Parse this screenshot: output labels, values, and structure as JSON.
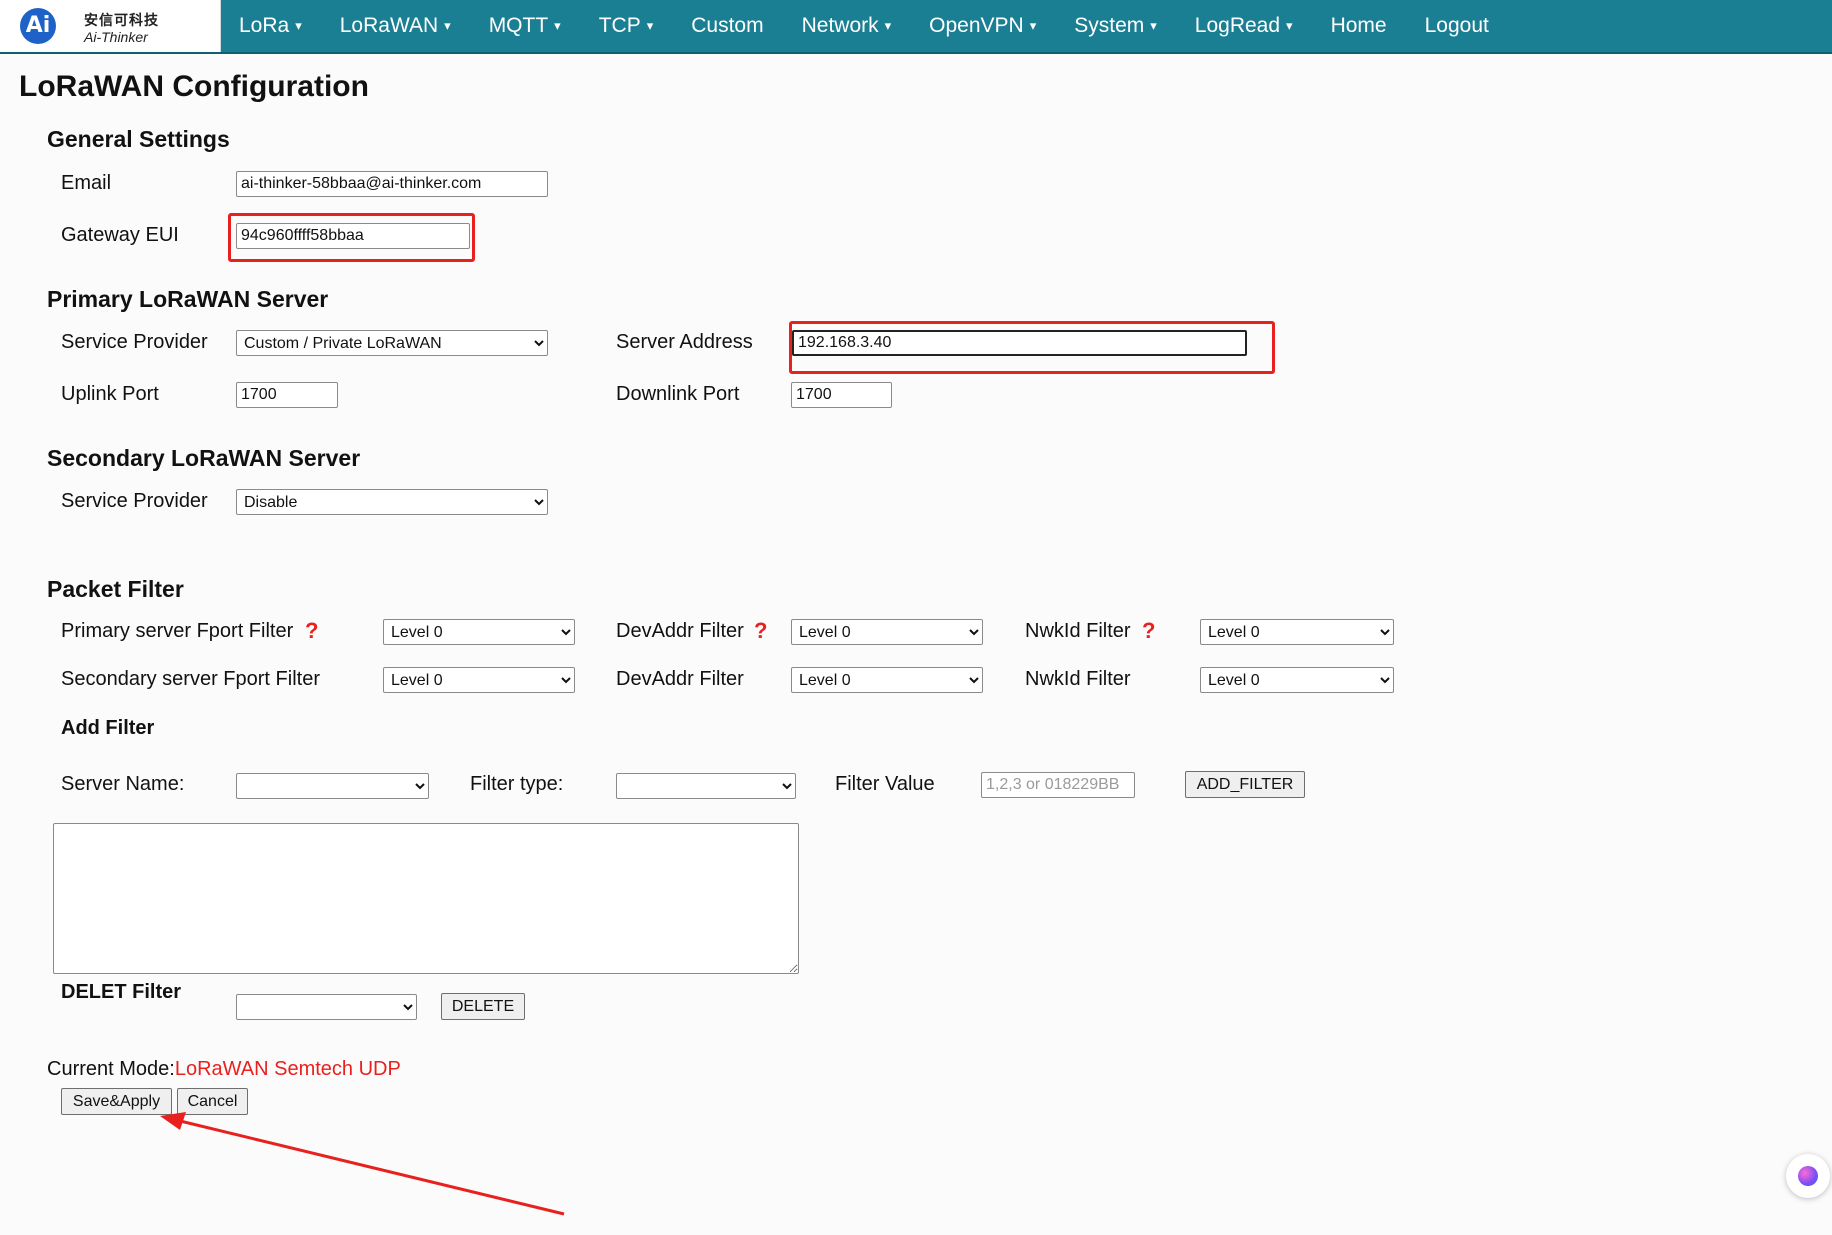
{
  "brand": {
    "cn": "安信可科技",
    "en": "Ai-Thinker",
    "mark": "Ai"
  },
  "nav": {
    "items": [
      {
        "label": "LoRa",
        "dropdown": true
      },
      {
        "label": "LoRaWAN",
        "dropdown": true
      },
      {
        "label": "MQTT",
        "dropdown": true
      },
      {
        "label": "TCP",
        "dropdown": true
      },
      {
        "label": "Custom",
        "dropdown": false
      },
      {
        "label": "Network",
        "dropdown": true
      },
      {
        "label": "OpenVPN",
        "dropdown": true
      },
      {
        "label": "System",
        "dropdown": true
      },
      {
        "label": "LogRead",
        "dropdown": true
      },
      {
        "label": "Home",
        "dropdown": false
      },
      {
        "label": "Logout",
        "dropdown": false
      }
    ],
    "caret": "▾"
  },
  "page": {
    "title": "LoRaWAN Configuration"
  },
  "general": {
    "heading": "General Settings",
    "email_label": "Email",
    "email_value": "ai-thinker-58bbaa@ai-thinker.com",
    "eui_label": "Gateway EUI",
    "eui_value": "94c960ffff58bbaa"
  },
  "primary": {
    "heading": "Primary LoRaWAN Server",
    "provider_label": "Service Provider",
    "provider_value": "Custom / Private LoRaWAN",
    "address_label": "Server Address",
    "address_value": "192.168.3.40",
    "uplink_label": "Uplink Port",
    "uplink_value": "1700",
    "downlink_label": "Downlink Port",
    "downlink_value": "1700"
  },
  "secondary": {
    "heading": "Secondary LoRaWAN Server",
    "provider_label": "Service Provider",
    "provider_value": "Disable"
  },
  "filter": {
    "heading": "Packet Filter",
    "primary_fport_label": "Primary server Fport Filter",
    "secondary_fport_label": "Secondary server Fport Filter",
    "devaddr_label": "DevAddr Filter",
    "nwkid_label": "NwkId Filter",
    "help_glyph": "?",
    "level_value": "Level 0",
    "add_heading": "Add Filter",
    "server_name_label": "Server Name:",
    "filter_type_label": "Filter type:",
    "filter_value_label": "Filter Value",
    "filter_value_placeholder": "1,2,3 or 018229BB",
    "add_button": "ADD_FILTER",
    "delete_heading": "DELET Filter",
    "delete_button": "DELETE"
  },
  "status": {
    "mode_label": "Current Mode:",
    "mode_value": "LoRaWAN Semtech UDP"
  },
  "actions": {
    "save": "Save&Apply",
    "cancel": "Cancel"
  },
  "annotation_color": "#e8211e"
}
